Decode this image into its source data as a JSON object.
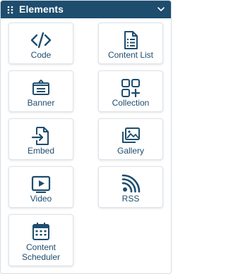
{
  "panel": {
    "title": "Elements"
  },
  "colors": {
    "header_bg": "#1e4d6e",
    "icon": "#1e4d6e",
    "label": "#1e4d6e",
    "tile_border": "#dde3ea"
  },
  "elements": [
    {
      "label": "Code",
      "icon": "code-icon"
    },
    {
      "label": "Content List",
      "icon": "content-list-icon"
    },
    {
      "label": "Banner",
      "icon": "banner-icon"
    },
    {
      "label": "Collection",
      "icon": "collection-icon"
    },
    {
      "label": "Embed",
      "icon": "embed-icon"
    },
    {
      "label": "Gallery",
      "icon": "gallery-icon"
    },
    {
      "label": "Video",
      "icon": "video-icon"
    },
    {
      "label": "RSS",
      "icon": "rss-icon"
    },
    {
      "label_line1": "Content",
      "label_line2": "Scheduler",
      "icon": "content-scheduler-icon"
    }
  ]
}
